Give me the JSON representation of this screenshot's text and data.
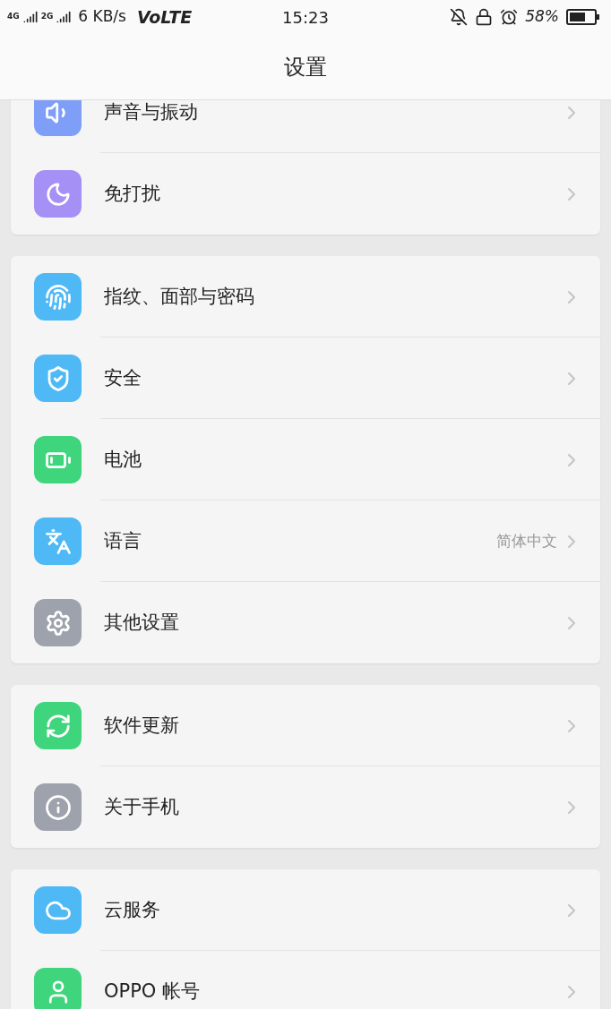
{
  "status_bar": {
    "network_1": "4G",
    "network_2": "2G",
    "speed": "6 KB/s",
    "volte": "VoLTE",
    "time": "15:23",
    "battery": "58%"
  },
  "header": {
    "title": "设置"
  },
  "groups": [
    {
      "items": [
        {
          "label": "声音与振动",
          "color": "#7f9ef8"
        },
        {
          "label": "免打扰",
          "color": "#a590f6"
        }
      ]
    },
    {
      "items": [
        {
          "label": "指纹、面部与密码",
          "color": "#4fb9f6"
        },
        {
          "label": "安全",
          "color": "#4fb9f6"
        },
        {
          "label": "电池",
          "color": "#3fd57c"
        },
        {
          "label": "语言",
          "value": "简体中文",
          "color": "#4fb9f6"
        },
        {
          "label": "其他设置",
          "color": "#9ea2ac"
        }
      ]
    },
    {
      "items": [
        {
          "label": "软件更新",
          "color": "#3fd57c"
        },
        {
          "label": "关于手机",
          "color": "#9ea2ac"
        }
      ]
    },
    {
      "items": [
        {
          "label": "云服务",
          "color": "#4fb9f6"
        },
        {
          "label": "OPPO 帐号",
          "color": "#3fd57c"
        }
      ]
    }
  ]
}
